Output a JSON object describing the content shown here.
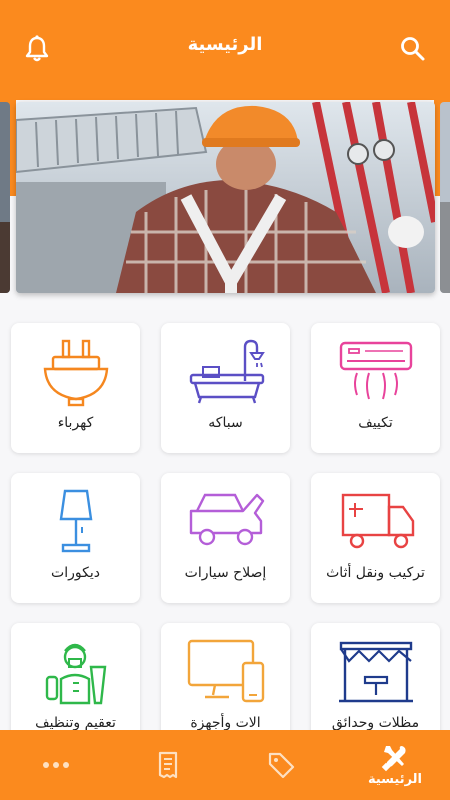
{
  "header": {
    "title": "الرئيسية",
    "icons": [
      "bell-icon",
      "search-icon"
    ]
  },
  "services": [
    {
      "label": "تكييف",
      "icon": "air-conditioner-icon",
      "color": "#e8439b"
    },
    {
      "label": "سباكه",
      "icon": "bathtub-icon",
      "color": "#5b4fc5"
    },
    {
      "label": "كهرباء",
      "icon": "plug-icon",
      "color": "#f5871f"
    },
    {
      "label": "تركيب ونقل أثاث",
      "icon": "truck-icon",
      "color": "#e84343"
    },
    {
      "label": "إصلاح سيارات",
      "icon": "car-icon",
      "color": "#b45ed8"
    },
    {
      "label": "ديكورات",
      "icon": "lamp-icon",
      "color": "#3b8fe0"
    },
    {
      "label": "مظلات وحدائق",
      "icon": "gazebo-icon",
      "color": "#1f3b8c"
    },
    {
      "label": "الات وأجهزة",
      "icon": "devices-icon",
      "color": "#f2a53a"
    },
    {
      "label": "تعقيم وتنظيف",
      "icon": "cleaner-icon",
      "color": "#2fb84a"
    }
  ],
  "bottom_nav": {
    "home_label": "الرئيسية",
    "icons": [
      "tools-icon",
      "tag-icon",
      "receipt-icon",
      "more-icon"
    ]
  },
  "colors": {
    "accent": "#fb8a1e",
    "background": "#f7f7f9"
  }
}
